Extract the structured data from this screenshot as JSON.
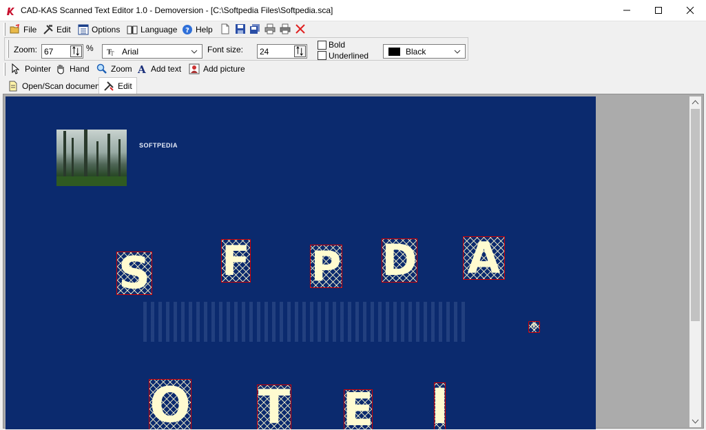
{
  "window": {
    "title": "CAD-KAS Scanned Text Editor 1.0 - Demoversion - [C:\\Softpedia Files\\Softpedia.sca]"
  },
  "menu": {
    "file": "File",
    "edit": "Edit",
    "options": "Options",
    "language": "Language",
    "help": "Help"
  },
  "format": {
    "zoom_label": "Zoom:",
    "zoom_value": "67",
    "zoom_unit": "%",
    "font_name": "Arial",
    "font_size_label": "Font size:",
    "font_size_value": "24",
    "bold_label": "Bold",
    "underlined_label": "Underlined",
    "color_value": "Black",
    "color_swatch": "#000000"
  },
  "tools": {
    "pointer": "Pointer",
    "hand": "Hand",
    "zoom": "Zoom",
    "add_text": "Add text",
    "add_picture": "Add picture"
  },
  "tabs": {
    "open_scan": "Open/Scan document",
    "edit": "Edit"
  },
  "document": {
    "logo_text": "SOFTPEDIA",
    "registered_mark": "®",
    "glyphs": [
      "S",
      "F",
      "P",
      "D",
      "A",
      "O",
      "T",
      "E",
      "I"
    ],
    "background_color": "#0b2a6e",
    "glyph_color": "#fffbd0",
    "selection_color": "#d40000"
  }
}
